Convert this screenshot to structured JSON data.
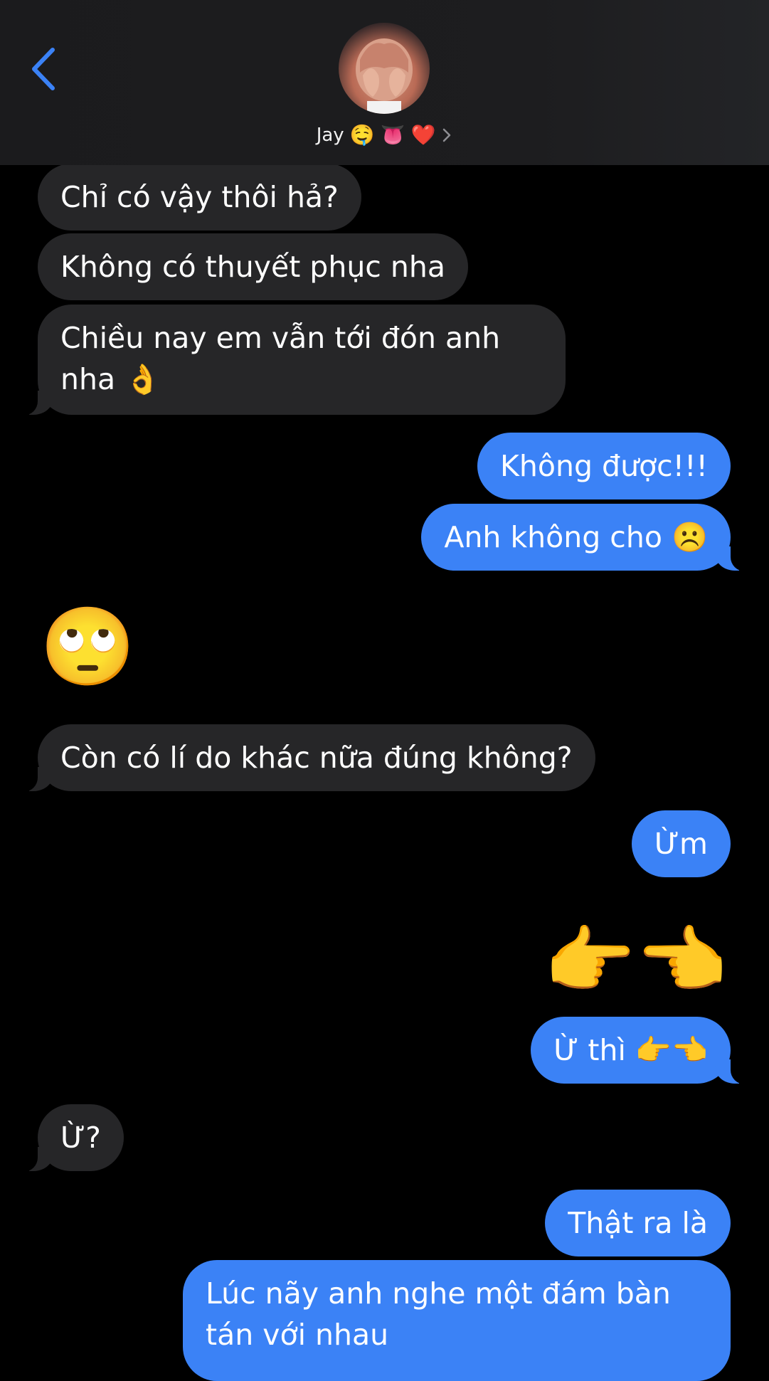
{
  "header": {
    "contact_name": "Jay",
    "contact_emojis": [
      "🤤",
      "👅",
      "❤️"
    ]
  },
  "messages": [
    {
      "from": "them",
      "text": "Chỉ có vậy thôi hả?"
    },
    {
      "from": "them",
      "text": "Không có thuyết phục nha"
    },
    {
      "from": "them",
      "text": "Chiều nay em vẫn tới đón anh nha 👌"
    },
    {
      "from": "me",
      "text": "Không được!!!"
    },
    {
      "from": "me",
      "text": "Anh không cho ☹️"
    },
    {
      "from": "them",
      "text": "🙄"
    },
    {
      "from": "them",
      "text": "Còn có lí do khác nữa đúng không?"
    },
    {
      "from": "me",
      "text": "Ừm"
    },
    {
      "from": "me",
      "text": "👉👈"
    },
    {
      "from": "me",
      "text": "Ừ thì 👉👈"
    },
    {
      "from": "them",
      "text": "Ừ?"
    },
    {
      "from": "me",
      "text": "Thật ra là"
    },
    {
      "from": "me",
      "text": "Lúc nãy anh nghe một đám bàn tán với nhau"
    }
  ],
  "colors": {
    "incoming_bubble": "#262628",
    "outgoing_bubble": "#3b82f6",
    "accent_back": "#3b82f6"
  }
}
